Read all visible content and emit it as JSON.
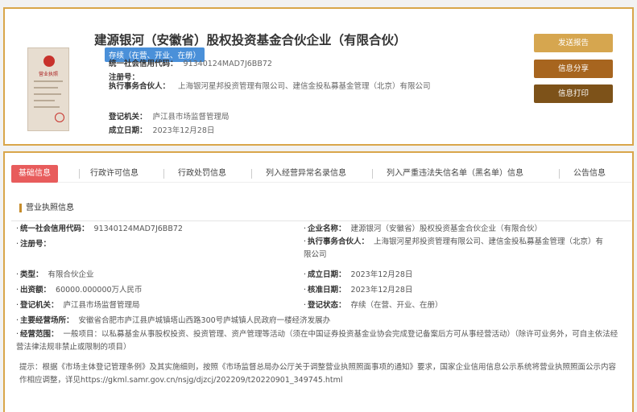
{
  "header": {
    "company_name": "建源银河（安徽省）股权投资基金合伙企业（有限合伙）",
    "status_tag": "存续（在营、开业、在册）",
    "license_caption": "营业执照",
    "rows": {
      "credit_code_label": "统一社会信用代码：",
      "credit_code_value": "91340124MAD7J6BB72",
      "reg_no_label": "注册号：",
      "reg_no_value": "",
      "partner_label": "执行事务合伙人：",
      "partner_value": "上海银河星邦投资管理有限公司、建信金投私募基金管理（北京）有限公司",
      "authority_label": "登记机关：",
      "authority_value": "庐江县市场监督管理局",
      "date_label": "成立日期：",
      "date_value": "2023年12月28日"
    },
    "buttons": {
      "send": "发送报告",
      "share": "信息分享",
      "print": "信息打印"
    }
  },
  "tabs": [
    {
      "label": "基础信息"
    },
    {
      "label": "行政许可信息"
    },
    {
      "label": "行政处罚信息"
    },
    {
      "label": "列入经营异常名录信息"
    },
    {
      "label": "列入严重违法失信名单（黑名单）信息"
    },
    {
      "label": "公告信息"
    }
  ],
  "section": {
    "title": "营业执照信息"
  },
  "fields": {
    "credit_code": {
      "label": "统一社会信用代码：",
      "value": "91340124MAD7J6BB72"
    },
    "company_name": {
      "label": "企业名称：",
      "value": "建源银河（安徽省）股权投资基金合伙企业（有限合伙）"
    },
    "reg_no": {
      "label": "注册号：",
      "value": ""
    },
    "partner": {
      "label": "执行事务合伙人：",
      "value": "上海银河星邦投资管理有限公司、建信金投私募基金管理（北京）有限公司"
    },
    "type": {
      "label": "类型：",
      "value": "有限合伙企业"
    },
    "established": {
      "label": "成立日期：",
      "value": "2023年12月28日"
    },
    "capital": {
      "label": "出资额：",
      "value": "60000.000000万人民币"
    },
    "approved": {
      "label": "核准日期：",
      "value": "2023年12月28日"
    },
    "authority": {
      "label": "登记机关：",
      "value": "庐江县市场监督管理局"
    },
    "reg_status": {
      "label": "登记状态：",
      "value": "存续（在营、开业、在册）"
    },
    "address": {
      "label": "主要经营场所：",
      "value": "安徽省合肥市庐江县庐城镇塔山西路300号庐城镇人民政府一楼经济发展办"
    },
    "scope": {
      "label": "经营范围：",
      "value": "一般项目：以私募基金从事股权投资、投资管理、资产管理等活动（须在中国证券投资基金业协会完成登记备案后方可从事经营活动）（除许可业务外，可自主依法经营法律法规非禁止或限制的项目）"
    }
  },
  "hint": "提示：根据《市场主体登记管理条例》及其实施细则，按照《市场监督总局办公厅关于调整营业执照照面事项的通知》要求，国家企业信用信息公示系统将营业执照照面公示内容作相应调整，详见https://gkml.samr.gov.cn/nsjg/djzcj/202209/t20220901_349745.html"
}
